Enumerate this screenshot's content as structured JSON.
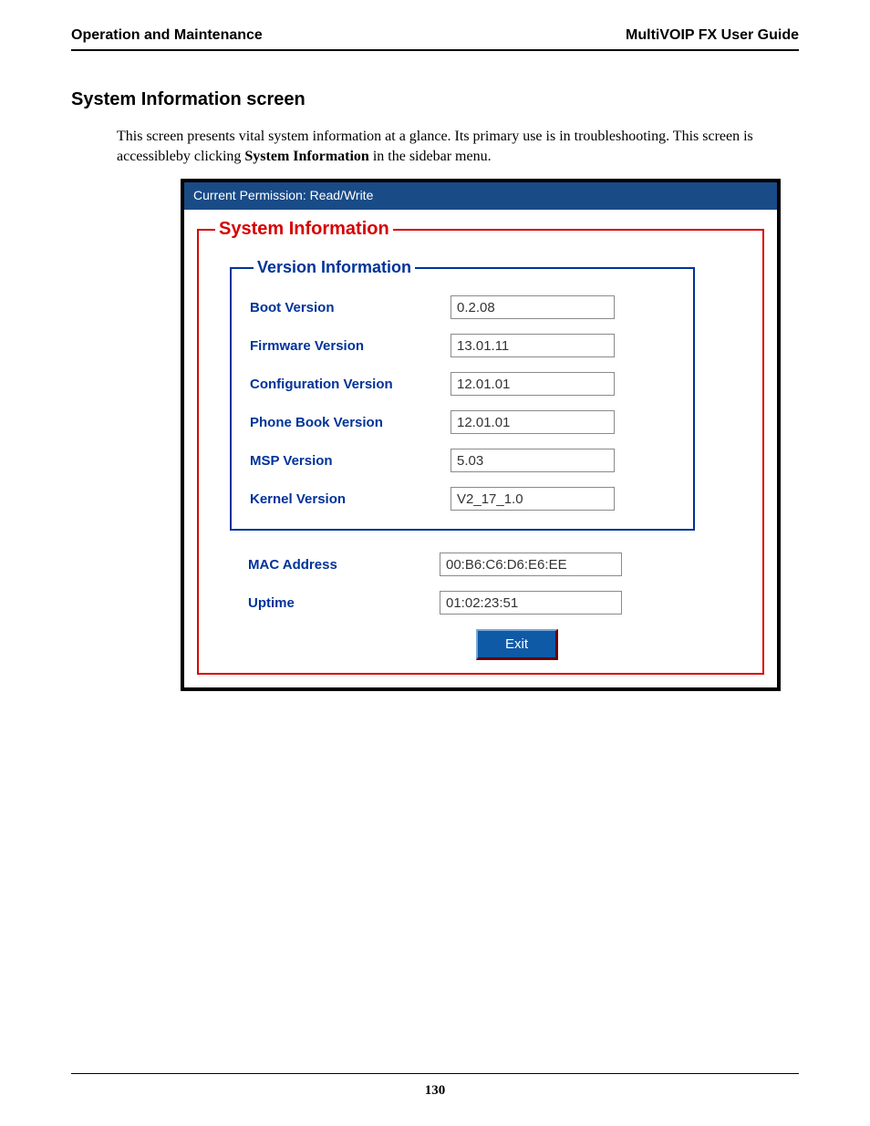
{
  "header": {
    "left": "Operation and Maintenance",
    "right": "MultiVOIP FX User Guide"
  },
  "section": {
    "title": "System Information screen",
    "intro_prefix": "This screen presents vital system information at a glance. Its primary use is in troubleshooting.  This screen is accessibleby clicking ",
    "intro_bold": "System Information",
    "intro_suffix": " in the  sidebar menu."
  },
  "panel": {
    "permission": "Current Permission:  Read/Write",
    "outer_legend": "System Information",
    "inner_legend": "Version Information",
    "version_rows": [
      {
        "label": "Boot Version",
        "value": "0.2.08"
      },
      {
        "label": "Firmware Version",
        "value": "13.01.11"
      },
      {
        "label": "Configuration Version",
        "value": "12.01.01"
      },
      {
        "label": "Phone Book Version",
        "value": "12.01.01"
      },
      {
        "label": "MSP Version",
        "value": "5.03"
      },
      {
        "label": "Kernel Version",
        "value": "V2_17_1.0"
      }
    ],
    "bottom_rows": [
      {
        "label": "MAC Address",
        "value": "00:B6:C6:D6:E6:EE"
      },
      {
        "label": "Uptime",
        "value": "01:02:23:51"
      }
    ],
    "exit_label": "Exit"
  },
  "footer": {
    "page_number": "130"
  }
}
